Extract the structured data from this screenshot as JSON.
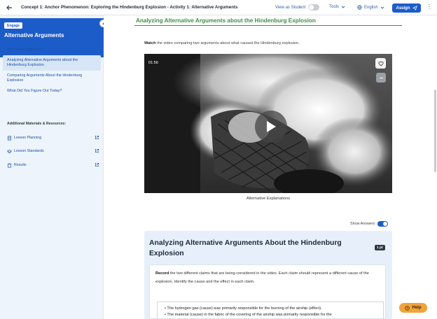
{
  "topbar": {
    "breadcrumb": "Concept 1: Anchor Phenomenon: Exploring the Hindenburg Explosion - Activity 1: Alternative Arguments",
    "view_as_student": "View as Student",
    "tools": "Tools",
    "language": "English",
    "assign": "Assign"
  },
  "sidebar": {
    "badge": "Engage",
    "title": "Alternative Arguments",
    "collapse_icon": "chevron-left-icon",
    "items": [
      {
        "label": "Alternative Arguments",
        "active": false
      },
      {
        "label": "Analyzing Alternative Arguments about the Hindenburg Explosion",
        "active": true
      },
      {
        "label": "Comparing Arguments About the Hindenburg Explosion",
        "active": false
      },
      {
        "label": "What Did You Figure Out Today?",
        "active": false
      }
    ],
    "resources_title": "Additional Materials & Resources:",
    "resources": [
      {
        "label": "Lesson Planning",
        "icon": "document-icon"
      },
      {
        "label": "Lesson Standards",
        "icon": "graduation-cap-icon"
      },
      {
        "label": "Results",
        "icon": "clipboard-icon"
      }
    ]
  },
  "main": {
    "title": "Analyzing Alternative Arguments about the Hindenburg Explosion",
    "watch_bold": "Watch",
    "watch_rest": " the video comparing two arguments about what caused the Hindenburg explosion.",
    "video": {
      "time": "01:56",
      "caption": "Alternative Explanations"
    },
    "show_answers": "Show Answers",
    "panel": {
      "title": "Analyzing Alternative Arguments About the Hindenburg Explosion",
      "points": "1 pt",
      "prompt_bold": "Record",
      "prompt_rest": " the two different claims that are being considered in the video. Each claim should represent a different cause of the explosion. Identify the cause and the effect in each claim.",
      "answers": [
        "The hydrogen gas (cause) was primarily responsible for the burning of the airship (effect).",
        "The material (cause) in the fabric of the covering of the airship was primarily responsible for the"
      ]
    }
  },
  "help": "Help",
  "colors": {
    "brand_blue": "#1c5cc9",
    "title_green": "#3f8f47",
    "help_orange": "#f1a33b"
  }
}
